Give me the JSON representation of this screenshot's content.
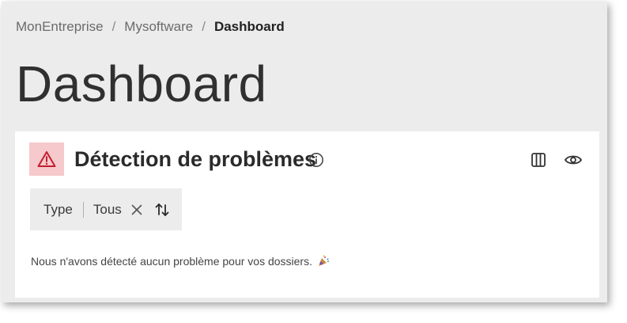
{
  "breadcrumb": {
    "items": [
      "MonEntreprise",
      "Mysoftware"
    ],
    "separator": "/",
    "current": "Dashboard"
  },
  "page": {
    "title": "Dashboard"
  },
  "card": {
    "title": "Détection de problèmes",
    "alert_icon": "warning-triangle-icon",
    "info_icon": "info-circle-icon",
    "columns_icon": "columns-icon",
    "visibility_icon": "eye-icon"
  },
  "filter": {
    "label": "Type",
    "value": "Tous",
    "clear_icon": "close-icon",
    "sort_icon": "sort-arrows-icon"
  },
  "empty_state": {
    "message": "Nous n'avons détecté aucun problème pour vos dossiers.",
    "icon": "party-popper-icon"
  },
  "colors": {
    "frame_bg": "#ececec",
    "alert_bg": "#f6c9cc",
    "alert_icon": "#c0202e",
    "text_dark": "#2b2b2b",
    "text_muted": "#6b6b6b"
  }
}
